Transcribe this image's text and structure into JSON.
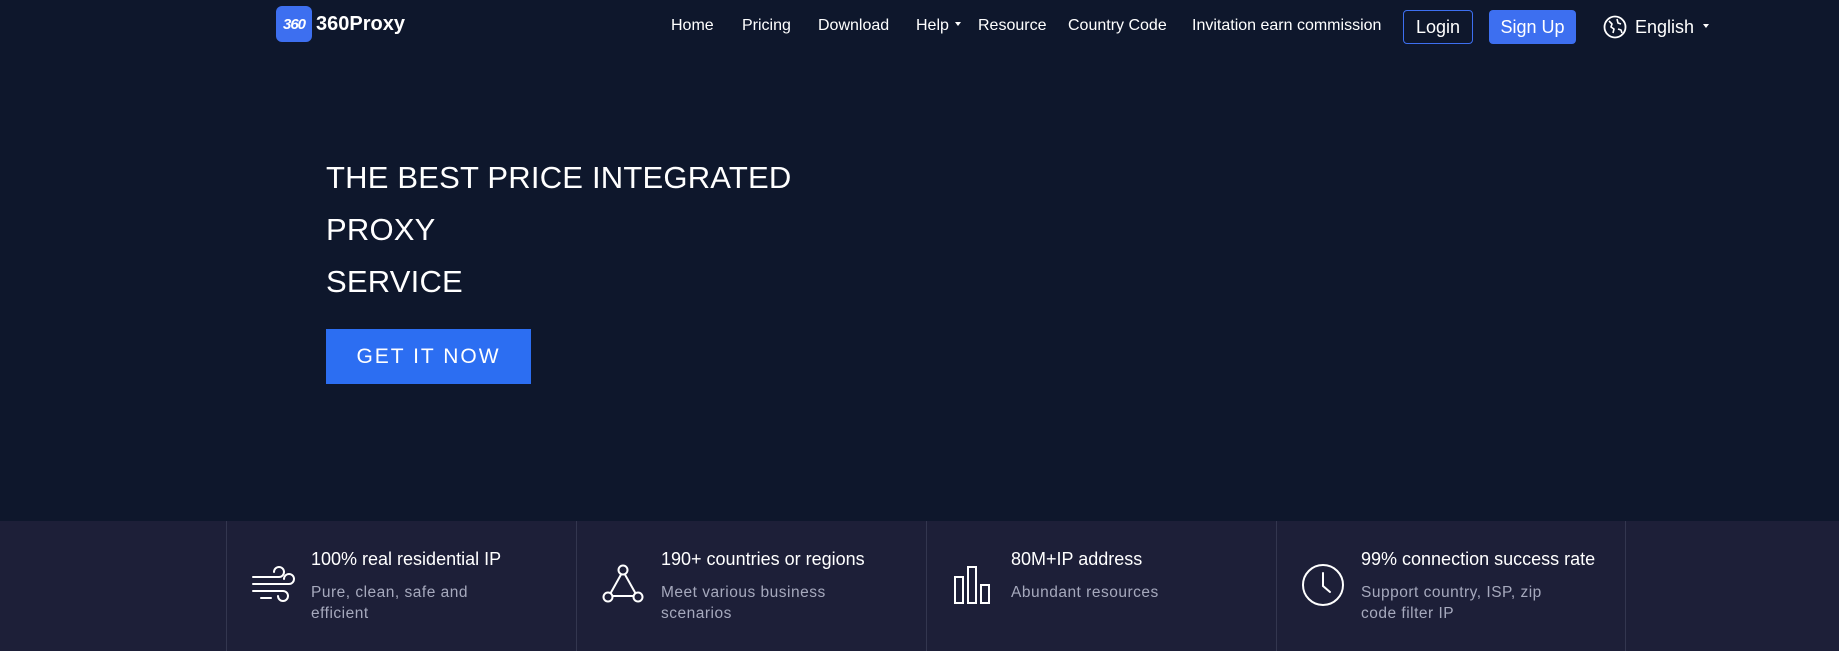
{
  "header": {
    "logo_badge": "360",
    "logo_text": "360Proxy",
    "nav": {
      "home": "Home",
      "pricing": "Pricing",
      "download": "Download",
      "help": "Help",
      "resource": "Resource",
      "country_code": "Country Code",
      "invitation": "Invitation earn commission"
    },
    "login": "Login",
    "signup": "Sign Up",
    "language": "English"
  },
  "hero": {
    "title_line1": "THE BEST PRICE INTEGRATED PROXY",
    "title_line2": "SERVICE",
    "cta": "GET IT NOW"
  },
  "features": [
    {
      "icon": "wind-icon",
      "title": "100% real residential IP",
      "desc": "Pure, clean, safe and efficient"
    },
    {
      "icon": "triangle-nodes-icon",
      "title": "190+ countries or regions",
      "desc": "Meet various business scenarios"
    },
    {
      "icon": "bar-chart-icon",
      "title": "80M+IP address",
      "desc": "Abundant resources"
    },
    {
      "icon": "clock-icon",
      "title": "99% connection success rate",
      "desc": "Support country, ISP, zip code filter IP"
    }
  ],
  "colors": {
    "background": "#0e172c",
    "features_band": "#1d1f38",
    "accent": "#3d6ff0",
    "cta": "#2c6ef2",
    "muted_text": "#a6a9bd"
  }
}
